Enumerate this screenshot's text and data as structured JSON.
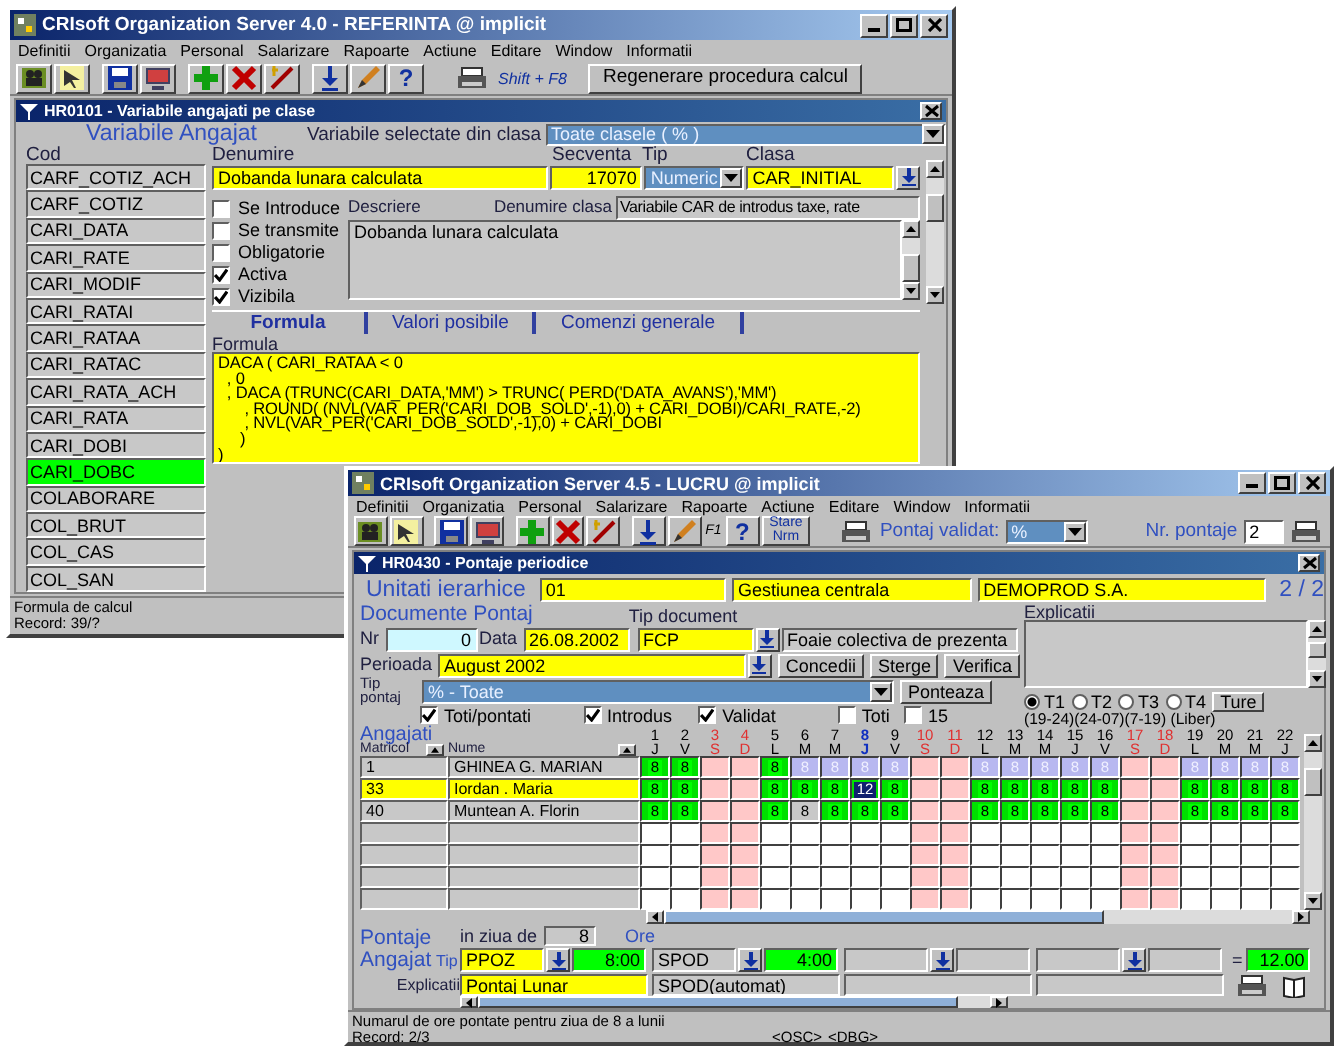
{
  "referinta_window": {
    "title": "CRIsoft Organization Server 4.0 - REFERINTA @ implicit",
    "menu": [
      "Definitii",
      "Organizatia",
      "Personal",
      "Salarizare",
      "Rapoarte",
      "Actiune",
      "Editare",
      "Window",
      "Informatii"
    ],
    "toolbar": {
      "help": "?",
      "shortcut": "Shift + F8",
      "action": "Regenerare procedura calcul"
    },
    "form": {
      "title": "HR0101 - Variabile angajati pe clase",
      "heading": "Variabile Angajat",
      "class_filter": {
        "label": "Variabile selectate din clasa",
        "value": "Toate clasele ( % )"
      },
      "codes": {
        "label": "Cod",
        "items": [
          {
            "text": "CARF_COTIZ_ACH",
            "selected": false
          },
          {
            "text": "CARF_COTIZ",
            "selected": false
          },
          {
            "text": "CARI_DATA",
            "selected": false
          },
          {
            "text": "CARI_RATE",
            "selected": false
          },
          {
            "text": "CARI_MODIF",
            "selected": false
          },
          {
            "text": "CARI_RATAI",
            "selected": false
          },
          {
            "text": "CARI_RATAA",
            "selected": false
          },
          {
            "text": "CARI_RATAC",
            "selected": false
          },
          {
            "text": "CARI_RATA_ACH",
            "selected": false
          },
          {
            "text": "CARI_RATA",
            "selected": false
          },
          {
            "text": "CARI_DOBI",
            "selected": false
          },
          {
            "text": "CARI_DOBC",
            "selected": true
          },
          {
            "text": "COLABORARE",
            "selected": false
          },
          {
            "text": "COL_BRUT",
            "selected": false
          },
          {
            "text": "COL_CAS",
            "selected": false
          },
          {
            "text": "COL_SAN",
            "selected": false
          }
        ]
      },
      "denumire": {
        "label": "Denumire",
        "value": "Dobanda lunara calculata"
      },
      "secventa": {
        "label": "Secventa",
        "value": "17070"
      },
      "tip": {
        "label": "Tip",
        "value": "Numeric"
      },
      "clasa": {
        "label": "Clasa",
        "value": "CAR_INITIAL"
      },
      "options": [
        {
          "label": "Se Introduce",
          "checked": false
        },
        {
          "label": "Se transmite",
          "checked": false
        },
        {
          "label": "Obligatorie",
          "checked": false
        },
        {
          "label": "Activa",
          "checked": true
        },
        {
          "label": "Vizibila",
          "checked": true
        }
      ],
      "descriere": {
        "label": "Descriere",
        "value": "Dobanda lunara calculata"
      },
      "denumire_clasa": {
        "label": "Denumire clasa",
        "value": "Variabile CAR de introdus taxe, rate"
      },
      "tabs": [
        {
          "label": "Formula",
          "selected": true
        },
        {
          "label": "Valori posibile",
          "selected": false
        },
        {
          "label": "Comenzi generale",
          "selected": false
        }
      ],
      "formula": {
        "label": "Formula",
        "text": "DACA ( CARI_RATAA < 0\n  , 0\n  , DACA (TRUNC(CARI_DATA,'MM') > TRUNC( PERD('DATA_AVANS'),'MM')\n      , ROUND( (NVL(VAR_PER('CARI_DOB_SOLD',-1),0) + CARI_DOBI)/CARI_RATE,-2)\n      , NVL(VAR_PER('CARI_DOB_SOLD',-1),0) + CARI_DOBI\n     )\n)"
      }
    },
    "status": {
      "message": "Formula de calcul",
      "record": "Record: 39/?"
    }
  },
  "lucru_window": {
    "title": "CRIsoft Organization Server 4.5 - LUCRU @ implicit",
    "menu": [
      "Definitii",
      "Organizatia",
      "Personal",
      "Salarizare",
      "Rapoarte",
      "Actiune",
      "Editare",
      "Window",
      "Informatii"
    ],
    "toolbar": {
      "key_hint": "F1",
      "help": "?",
      "state_button": "Stare\nNrm",
      "validated": {
        "label": "Pontaj validat:",
        "value": "%"
      },
      "count": {
        "label": "Nr. pontaje",
        "value": "2"
      }
    },
    "form": {
      "title": "HR0430 - Pontaje periodice",
      "unit": {
        "label": "Unitati ierarhice",
        "code": "01",
        "name": "Gestiunea centrala",
        "company": "DEMOPROD S.A.",
        "pager": "2 / 2"
      },
      "documents_heading": "Documente Pontaj",
      "nr": {
        "label": "Nr",
        "value": "0"
      },
      "data": {
        "label": "Data",
        "value": "26.08.2002"
      },
      "doc_type": {
        "label": "Tip document",
        "code": "FCP",
        "name": "Foaie colectiva de prezenta"
      },
      "period": {
        "label": "Perioada",
        "value": "August 2002"
      },
      "actions": [
        "Concedii",
        "Sterge",
        "Verifica"
      ],
      "pontaj_type": {
        "label": "Tip\npontaj",
        "value": "% - Toate"
      },
      "ponteaza": "Ponteaza",
      "explicatii_label": "Explicatii",
      "filters": [
        {
          "label": "Toti/pontati",
          "checked": true
        },
        {
          "label": "Introdus",
          "checked": true
        },
        {
          "label": "Validat",
          "checked": true
        },
        {
          "label": "Toti",
          "checked": false
        },
        {
          "label": "15",
          "checked": false
        }
      ],
      "shifts": [
        {
          "label": "T1",
          "selected": true
        },
        {
          "label": "T2",
          "selected": false
        },
        {
          "label": "T3",
          "selected": false
        },
        {
          "label": "T4",
          "selected": false
        }
      ],
      "shifts_button": "Ture",
      "shifts_note": "(19-24)(24-07)(7-19) (Liber)",
      "employees_heading": "Angajati",
      "columns": [
        "Matricol",
        "Nume"
      ],
      "days": [
        {
          "number": "1",
          "weekday": "J",
          "weekend": false,
          "selected": false
        },
        {
          "number": "2",
          "weekday": "V",
          "weekend": false,
          "selected": false
        },
        {
          "number": "3",
          "weekday": "S",
          "weekend": true,
          "selected": false
        },
        {
          "number": "4",
          "weekday": "D",
          "weekend": true,
          "selected": false
        },
        {
          "number": "5",
          "weekday": "L",
          "weekend": false,
          "selected": false
        },
        {
          "number": "6",
          "weekday": "M",
          "weekend": false,
          "selected": false
        },
        {
          "number": "7",
          "weekday": "M",
          "weekend": false,
          "selected": false
        },
        {
          "number": "8",
          "weekday": "J",
          "weekend": false,
          "selected": true
        },
        {
          "number": "9",
          "weekday": "V",
          "weekend": false,
          "selected": false
        },
        {
          "number": "10",
          "weekday": "S",
          "weekend": true,
          "selected": false
        },
        {
          "number": "11",
          "weekday": "D",
          "weekend": true,
          "selected": false
        },
        {
          "number": "12",
          "weekday": "L",
          "weekend": false,
          "selected": false
        },
        {
          "number": "13",
          "weekday": "M",
          "weekend": false,
          "selected": false
        },
        {
          "number": "14",
          "weekday": "M",
          "weekend": false,
          "selected": false
        },
        {
          "number": "15",
          "weekday": "J",
          "weekend": false,
          "selected": false
        },
        {
          "number": "16",
          "weekday": "V",
          "weekend": false,
          "selected": false
        },
        {
          "number": "17",
          "weekday": "S",
          "weekend": true,
          "selected": false
        },
        {
          "number": "18",
          "weekday": "D",
          "weekend": true,
          "selected": false
        },
        {
          "number": "19",
          "weekday": "L",
          "weekend": false,
          "selected": false
        },
        {
          "number": "20",
          "weekday": "M",
          "weekend": false,
          "selected": false
        },
        {
          "number": "21",
          "weekday": "M",
          "weekend": false,
          "selected": false
        },
        {
          "number": "22",
          "weekday": "J",
          "weekend": false,
          "selected": false
        }
      ],
      "rows": [
        {
          "matricol": "1",
          "name": "GHINEA G. MARIAN",
          "selected": false,
          "cells": [
            {
              "kind": "worked",
              "value": "8"
            },
            {
              "kind": "worked",
              "value": "8"
            },
            {
              "kind": "empty"
            },
            {
              "kind": "empty"
            },
            {
              "kind": "worked",
              "value": "8"
            },
            {
              "kind": "planned",
              "value": "8"
            },
            {
              "kind": "planned",
              "value": "8"
            },
            {
              "kind": "planned",
              "value": "8"
            },
            {
              "kind": "planned",
              "value": "8"
            },
            {
              "kind": "empty"
            },
            {
              "kind": "empty"
            },
            {
              "kind": "planned",
              "value": "8"
            },
            {
              "kind": "planned",
              "value": "8"
            },
            {
              "kind": "planned",
              "value": "8"
            },
            {
              "kind": "planned",
              "value": "8"
            },
            {
              "kind": "planned",
              "value": "8"
            },
            {
              "kind": "empty"
            },
            {
              "kind": "empty"
            },
            {
              "kind": "planned",
              "value": "8"
            },
            {
              "kind": "planned",
              "value": "8"
            },
            {
              "kind": "planned",
              "value": "8"
            },
            {
              "kind": "planned",
              "value": "8"
            }
          ]
        },
        {
          "matricol": "33",
          "name": "Iordan . Maria",
          "selected": true,
          "cells": [
            {
              "kind": "worked",
              "value": "8"
            },
            {
              "kind": "worked",
              "value": "8"
            },
            {
              "kind": "empty"
            },
            {
              "kind": "empty"
            },
            {
              "kind": "worked",
              "value": "8"
            },
            {
              "kind": "worked",
              "value": "8"
            },
            {
              "kind": "worked",
              "value": "8"
            },
            {
              "kind": "worked",
              "value": "12",
              "selected": true
            },
            {
              "kind": "worked",
              "value": "8"
            },
            {
              "kind": "empty"
            },
            {
              "kind": "empty"
            },
            {
              "kind": "worked",
              "value": "8"
            },
            {
              "kind": "worked",
              "value": "8"
            },
            {
              "kind": "worked",
              "value": "8"
            },
            {
              "kind": "worked",
              "value": "8"
            },
            {
              "kind": "worked",
              "value": "8"
            },
            {
              "kind": "empty"
            },
            {
              "kind": "empty"
            },
            {
              "kind": "worked",
              "value": "8"
            },
            {
              "kind": "worked",
              "value": "8"
            },
            {
              "kind": "worked",
              "value": "8"
            },
            {
              "kind": "worked",
              "value": "8"
            }
          ]
        },
        {
          "matricol": "40",
          "name": "Muntean A. Florin",
          "selected": false,
          "cells": [
            {
              "kind": "worked",
              "value": "8"
            },
            {
              "kind": "worked",
              "value": "8"
            },
            {
              "kind": "empty"
            },
            {
              "kind": "empty"
            },
            {
              "kind": "worked",
              "value": "8"
            },
            {
              "kind": "plain",
              "value": "8"
            },
            {
              "kind": "worked",
              "value": "8"
            },
            {
              "kind": "worked",
              "value": "8"
            },
            {
              "kind": "worked",
              "value": "8"
            },
            {
              "kind": "empty"
            },
            {
              "kind": "empty"
            },
            {
              "kind": "worked",
              "value": "8"
            },
            {
              "kind": "worked",
              "value": "8"
            },
            {
              "kind": "worked",
              "value": "8"
            },
            {
              "kind": "worked",
              "value": "8"
            },
            {
              "kind": "worked",
              "value": "8"
            },
            {
              "kind": "empty"
            },
            {
              "kind": "empty"
            },
            {
              "kind": "worked",
              "value": "8"
            },
            {
              "kind": "worked",
              "value": "8"
            },
            {
              "kind": "worked",
              "value": "8"
            },
            {
              "kind": "worked",
              "value": "8"
            }
          ]
        }
      ],
      "entry": {
        "heading": "Pontaje\nAngajat",
        "day": {
          "label": "in ziua de",
          "value": "8"
        },
        "hours_label": "Ore",
        "type_label": "Tip",
        "note_label": "Explicatii",
        "slots": [
          {
            "kind": "manual",
            "code": "PPOZ",
            "hours": "8:00",
            "note": "Pontaj Lunar"
          },
          {
            "kind": "auto",
            "code": "SPOD",
            "hours": "4:00",
            "note": "SPOD(automat)"
          },
          {
            "kind": "blank"
          },
          {
            "kind": "blank"
          }
        ],
        "equals": "=",
        "total": "12.00"
      }
    },
    "status": {
      "message": "Numarul de ore pontate pentru ziua de 8 a lunii",
      "record": "Record: 2/3",
      "tags": [
        "<OSC>",
        "<DBG>"
      ]
    }
  }
}
